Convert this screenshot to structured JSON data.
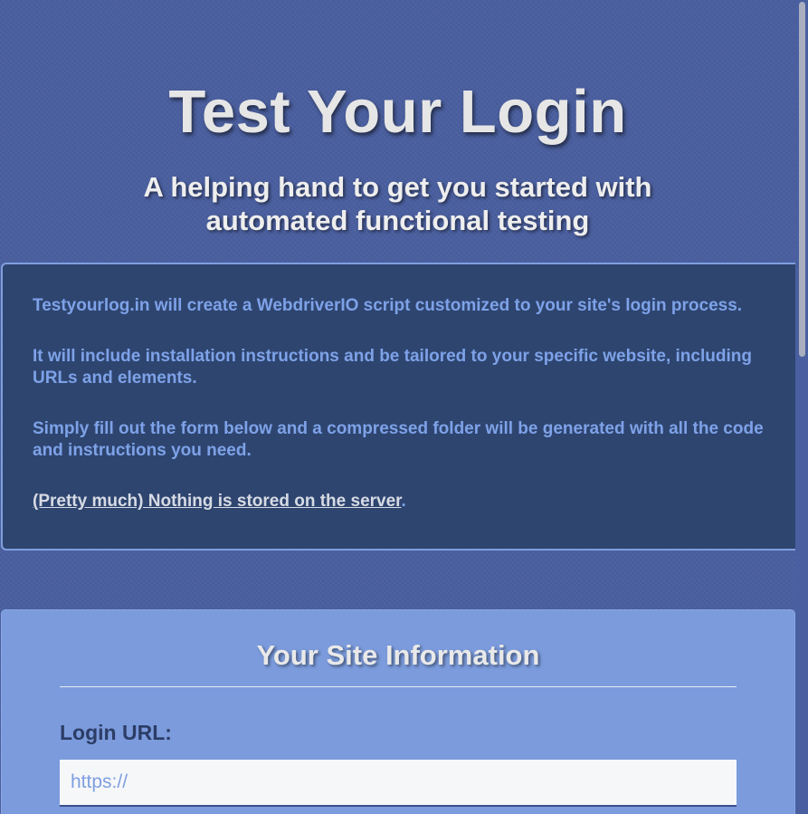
{
  "header": {
    "title": "Test Your Login",
    "subtitle": "A helping hand to get you started with automated functional testing"
  },
  "intro": {
    "paragraphs": [
      "Testyourlog.in will create a WebdriverIO script customized to your site's login process.",
      "It will include installation instructions and be tailored to your specific website, including URLs and elements.",
      "Simply fill out the form below and a compressed folder will be generated with all the code and instructions you need."
    ],
    "privacy_link": "(Pretty much) Nothing is stored on the server",
    "privacy_suffix": "."
  },
  "form": {
    "title": "Your Site Information",
    "login_url_label": "Login URL:",
    "login_url_value": "https://"
  },
  "colors": {
    "background": "#4a5fa0",
    "info_box": "#2e4570",
    "info_text": "#7ea2e8",
    "form_box": "#7b9bdc",
    "label_text": "#2c3d66"
  }
}
